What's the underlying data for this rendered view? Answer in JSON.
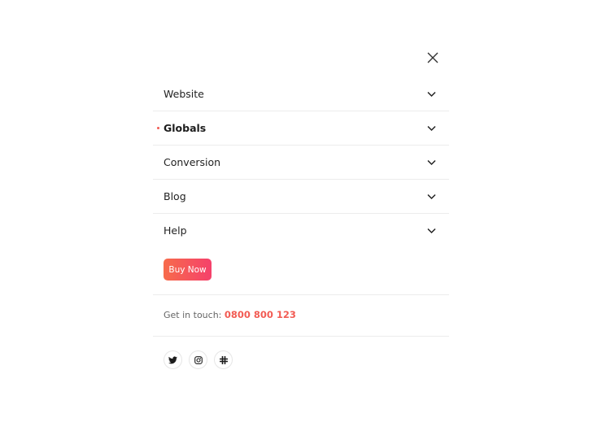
{
  "menu": {
    "items": [
      {
        "label": "Website",
        "active": false
      },
      {
        "label": "Globals",
        "active": true
      },
      {
        "label": "Conversion",
        "active": false
      },
      {
        "label": "Blog",
        "active": false
      },
      {
        "label": "Help",
        "active": false
      }
    ]
  },
  "cta": {
    "buy_label": "Buy Now"
  },
  "contact": {
    "prefix": "Get in touch:",
    "phone": "0800 800 123"
  },
  "socials": [
    "twitter-icon",
    "instagram-icon",
    "slack-icon"
  ],
  "colors": {
    "accent": "#f25c54",
    "gradient_start": "#f76b4b",
    "gradient_end": "#f5416b"
  }
}
